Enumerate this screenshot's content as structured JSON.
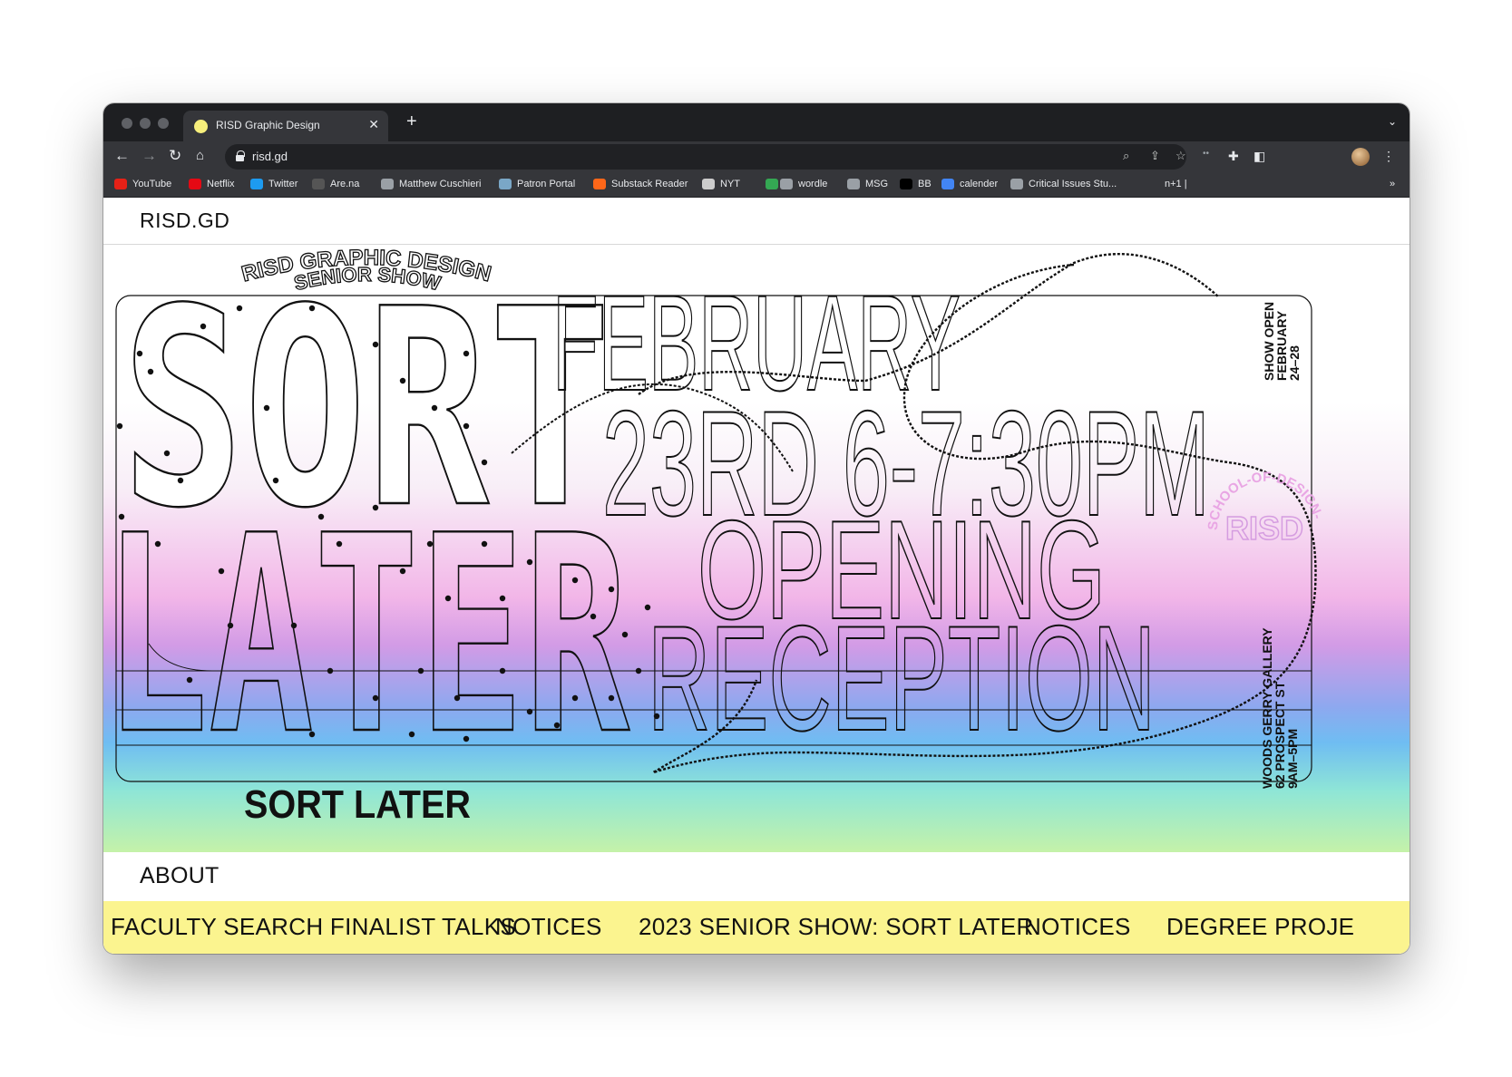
{
  "browser": {
    "tab_title": "RISD Graphic Design",
    "url": "risd.gd",
    "bookmarks": [
      {
        "label": "YouTube",
        "icon": "youtube-icon",
        "color": "#e62117"
      },
      {
        "label": "Netflix",
        "icon": "netflix-icon",
        "color": "#e50914"
      },
      {
        "label": "Twitter",
        "icon": "twitter-icon",
        "color": "#1d9bf0"
      },
      {
        "label": "Are.na",
        "icon": "arena-icon",
        "color": "#555555"
      },
      {
        "label": "Matthew Cuschieri",
        "icon": "globe-icon",
        "color": "#9aa0a6"
      },
      {
        "label": "Patron Portal",
        "icon": "patron-icon",
        "color": "#7aa7c7"
      },
      {
        "label": "Substack Reader",
        "icon": "substack-icon",
        "color": "#ff6719"
      },
      {
        "label": "NYT",
        "icon": "nyt-icon",
        "color": "#cccccc"
      },
      {
        "label": "",
        "icon": "drive-icon",
        "color": "#34a853"
      },
      {
        "label": "wordle",
        "icon": "globe-icon",
        "color": "#9aa0a6"
      },
      {
        "label": "MSG",
        "icon": "globe-icon",
        "color": "#9aa0a6"
      },
      {
        "label": "BB",
        "icon": "bb-icon",
        "color": "#000000"
      },
      {
        "label": "calender",
        "icon": "calendar-icon",
        "color": "#4285f4"
      },
      {
        "label": "Critical Issues Stu...",
        "icon": "globe-icon",
        "color": "#9aa0a6"
      },
      {
        "label": "n+1 |",
        "icon": "",
        "color": ""
      }
    ],
    "more_bookmarks": "»"
  },
  "site": {
    "logo": "RISD.GD",
    "about": "ABOUT"
  },
  "hero": {
    "arc_top": "RISD GRAPHIC DESIGN",
    "arc_sub": "SENIOR SHOW",
    "title_line1": "SORT",
    "title_line2": "LATER",
    "date_line1": "FEBRUARY",
    "date_line2": "23RD 6-7:30PM",
    "event_line1": "OPENING",
    "event_line2": "RECEPTION",
    "bottom_title": "SORT LATER",
    "side_top_1": "SHOW OPEN",
    "side_top_2": "FEBRUARY",
    "side_top_3": "24–28",
    "side_bottom_1": "WOODS GERRY GALLERY",
    "side_bottom_2": "62 PROSPECT ST",
    "side_bottom_3": "9AM–5PM",
    "badge_letters": "RISD",
    "badge_ring": "SCHOOL-OF-DESIGN-"
  },
  "ticker": {
    "items": [
      "FACULTY SEARCH FINALIST TALKS",
      "NOTICES",
      "2023 SENIOR SHOW: SORT LATER",
      "NOTICES",
      "DEGREE PROJE"
    ]
  },
  "colors": {
    "ticker_bg": "#fbf48f",
    "tab_favicon": "#f7ef7c"
  }
}
